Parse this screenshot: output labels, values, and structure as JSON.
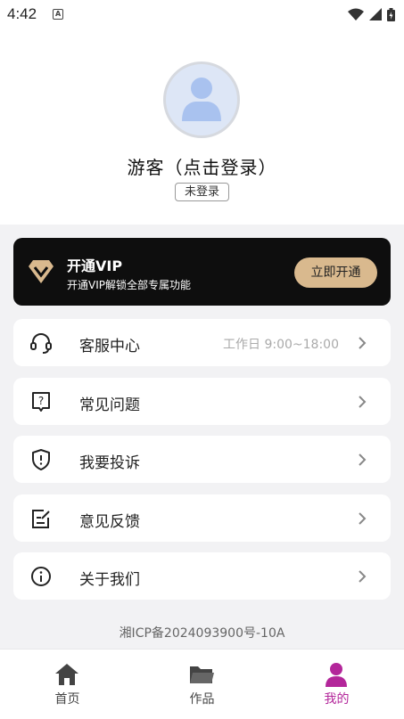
{
  "status_bar": {
    "time": "4:42"
  },
  "profile": {
    "username": "游客（点击登录）",
    "login_status": "未登录"
  },
  "vip": {
    "title": "开通VIP",
    "subtitle": "开通VIP解锁全部专属功能",
    "button_label": "立即开通",
    "accent": "#d9b98e"
  },
  "menu": [
    {
      "label": "客服中心",
      "extra": "工作日 9:00~18:00",
      "icon": "headset-icon"
    },
    {
      "label": "常见问题",
      "extra": "",
      "icon": "question-icon"
    },
    {
      "label": "我要投诉",
      "extra": "",
      "icon": "shield-alert-icon"
    },
    {
      "label": "意见反馈",
      "extra": "",
      "icon": "edit-note-icon"
    },
    {
      "label": "关于我们",
      "extra": "",
      "icon": "info-icon"
    }
  ],
  "footer": {
    "icp": "湘ICP备2024093900号-10A"
  },
  "tabs": [
    {
      "label": "首页",
      "icon": "home-icon",
      "active": false
    },
    {
      "label": "作品",
      "icon": "folder-icon",
      "active": false
    },
    {
      "label": "我的",
      "icon": "person-icon",
      "active": true
    }
  ],
  "colors": {
    "active_tab": "#b3269a",
    "background": "#f2f2f4"
  }
}
